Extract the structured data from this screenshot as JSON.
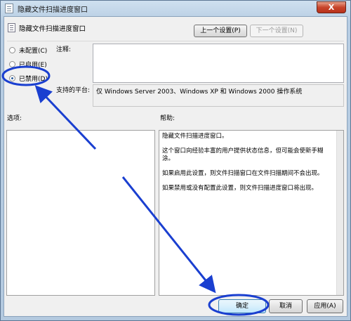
{
  "window": {
    "title": "隐藏文件扫描进度窗口",
    "close_glyph": "X"
  },
  "header": {
    "title": "隐藏文件扫描进度窗口",
    "prev_label": "上一个设置(P)",
    "next_label": "下一个设置(N)"
  },
  "state": {
    "options": [
      {
        "label": "未配置(C)",
        "checked": false
      },
      {
        "label": "已启用(E)",
        "checked": false
      },
      {
        "label": "已禁用(D)",
        "checked": true
      }
    ]
  },
  "comment": {
    "label": "注释:",
    "value": ""
  },
  "platform": {
    "label": "支持的平台:",
    "value": "仅 Windows Server 2003、Windows XP 和 Windows 2000 操作系统"
  },
  "options_panel": {
    "label": "选项:"
  },
  "help": {
    "label": "帮助:",
    "paragraphs": [
      "隐藏文件扫描进度窗口。",
      "这个窗口向经验丰富的用户提供状态信息，但可能会使新手糊涂。",
      "如果启用此设置，则文件扫描窗口在文件扫描期间不会出现。",
      "如果禁用或没有配置此设置，则文件扫描进度窗口将出现。"
    ]
  },
  "footer": {
    "ok_label": "确定",
    "cancel_label": "取消",
    "apply_label": "应用(A)"
  },
  "annotation": {
    "color": "#1a3fd0"
  }
}
